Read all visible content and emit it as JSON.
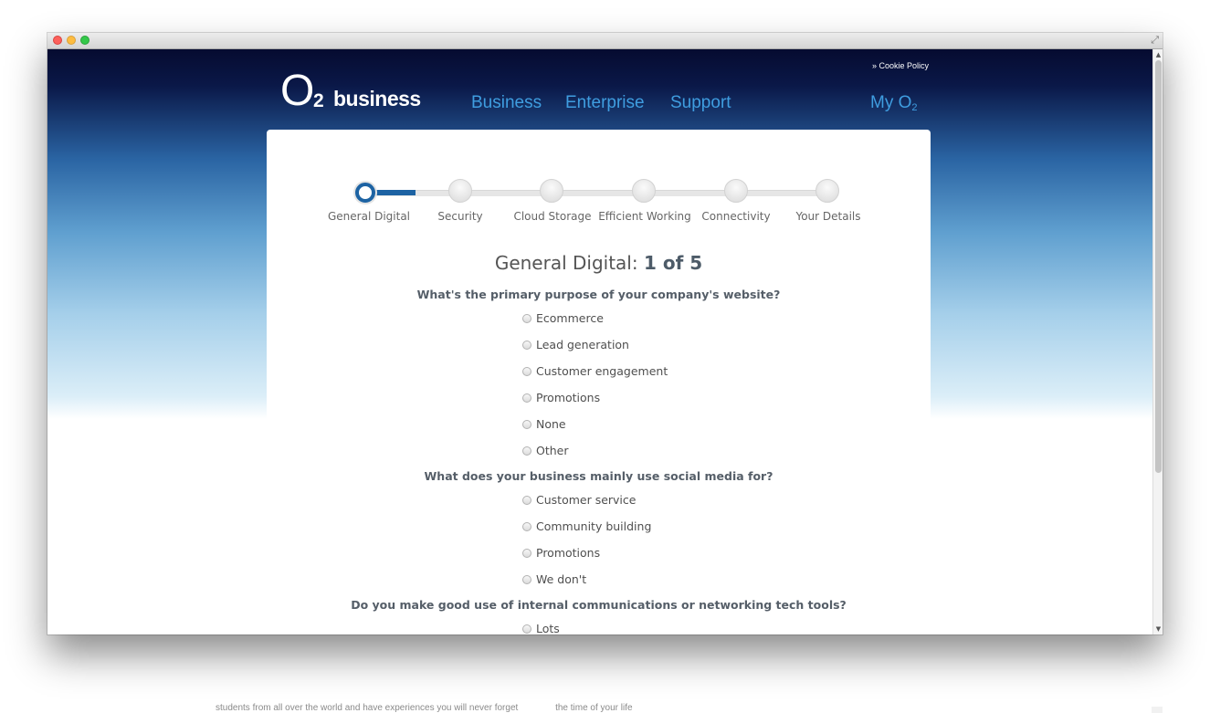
{
  "background_text": [
    "students from all over the world and have experiences you will never forget",
    "the time of your life"
  ],
  "header": {
    "cookie_link": "» Cookie Policy",
    "logo": {
      "o": "O",
      "sub": "2",
      "word": "business"
    },
    "nav": [
      "Business",
      "Enterprise",
      "Support"
    ],
    "my_o2": {
      "text": "My O",
      "sub": "2"
    }
  },
  "progress": {
    "steps": [
      "General Digital",
      "Security",
      "Cloud Storage",
      "Efficient Working",
      "Connectivity",
      "Your Details"
    ],
    "current_step": 1
  },
  "survey": {
    "heading_prefix": "General Digital: ",
    "heading_count": "1 of 5",
    "questions": [
      {
        "text": "What's the primary purpose of your company's website?",
        "options": [
          "Ecommerce",
          "Lead generation",
          "Customer engagement",
          "Promotions",
          "None",
          "Other"
        ]
      },
      {
        "text": "What does your business mainly use social media for?",
        "options": [
          "Customer service",
          "Community building",
          "Promotions",
          "We don't"
        ]
      },
      {
        "text": "Do you make good use of internal communications or networking tech tools?",
        "options": [
          "Lots"
        ]
      }
    ]
  }
}
